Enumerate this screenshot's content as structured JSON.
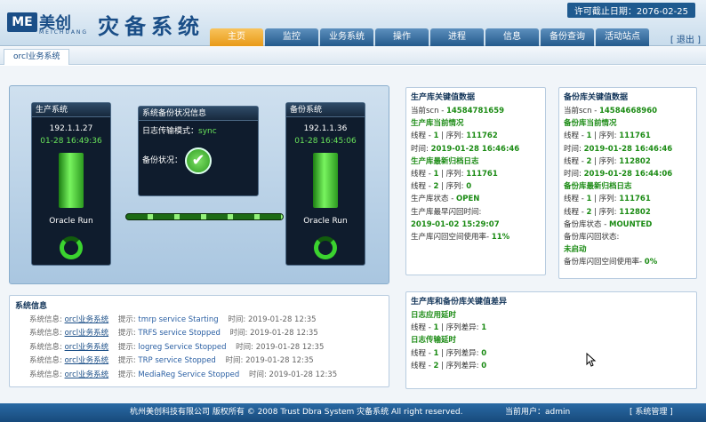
{
  "header": {
    "logo_mark": "ME",
    "logo_brand": "美创",
    "logo_sub": "MEICHUANG",
    "app_title": "灾备系统",
    "license": "许可截止日期：2076-02-25",
    "logout": "[ 退出 ]"
  },
  "nav": [
    "主页",
    "监控",
    "业务系统",
    "操作",
    "进程",
    "信息",
    "备份查询",
    "活动站点"
  ],
  "tab": "orcl业务系统",
  "production": {
    "title": "生产系统",
    "ip": "192.1.1.27",
    "time": "01-28 16:49:36",
    "status": "Oracle Run"
  },
  "backup_status": {
    "title": "系统备份状况信息",
    "mode_label": "日志传输模式：",
    "mode_value": "sync",
    "status_label": "备份状况："
  },
  "backup": {
    "title": "备份系统",
    "ip": "192.1.1.36",
    "time": "01-28 16:45:06",
    "status": "Oracle Run"
  },
  "prod_key": {
    "title": "生产库关键值数据",
    "scn_label": "当前scn - ",
    "scn": "14584781659",
    "cur_title": "生产库当前情况",
    "thread_label": "线程 - ",
    "thread": "1",
    "seq_label": " | 序列: ",
    "seq": "111762",
    "time_label": "时间: ",
    "time": "2019-01-28 16:46:46",
    "arch_title": "生产库最新归档日志",
    "a1_thread": "1",
    "a1_seq": "111761",
    "a2_thread": "2",
    "a2_seq": "0",
    "state_label": "生产库状态 - ",
    "state": "OPEN",
    "flash_label": "生产库最早闪回时间:",
    "flash_time": "2019-01-02 15:29:07",
    "usage_label": "生产库闪回空间使用率- ",
    "usage": "11%"
  },
  "backup_key": {
    "title": "备份库关键值数据",
    "scn_label": "当前scn - ",
    "scn": "14584668960",
    "cur_title": "备份库当前情况",
    "t1_thread": "1",
    "t1_seq": "111761",
    "time_label": "时间: ",
    "t1_time": "2019-01-28 16:46:46",
    "t2_thread": "2",
    "t2_seq": "112802",
    "t2_time": "2019-01-28 16:44:06",
    "arch_title": "备份库最新归档日志",
    "a1_thread": "1",
    "a1_seq": "111761",
    "a2_thread": "2",
    "a2_seq": "112802",
    "state_label": "备份库状态 - ",
    "state": "MOUNTED",
    "flash_label": "备份库闪回状态:",
    "flash_state": "未启动",
    "usage_label": "备份库闪回空间使用率- ",
    "usage": "0%"
  },
  "diff": {
    "title": "生产库和备份库关键值差异",
    "apply_title": "日志应用延时",
    "apply_thread": "1",
    "apply_diff": "1",
    "transfer_title": "日志传输延时",
    "t1_thread": "1",
    "t1_diff": "0",
    "t2_thread": "2",
    "t2_diff": "0",
    "diff_label": " | 序列差异: "
  },
  "sysinfo": {
    "title": "系统信息",
    "rows": [
      {
        "label": "系统信息:",
        "link": "orcl业务系统",
        "tip": "提示:",
        "msg": "tmrp service Starting",
        "time_label": "时间:",
        "time": "2019-01-28 12:35"
      },
      {
        "label": "系统信息:",
        "link": "orcl业务系统",
        "tip": "提示:",
        "msg": "TRFS service Stopped",
        "time_label": "时间:",
        "time": "2019-01-28 12:35"
      },
      {
        "label": "系统信息:",
        "link": "orcl业务系统",
        "tip": "提示:",
        "msg": "logreg Service Stopped",
        "time_label": "时间:",
        "time": "2019-01-28 12:35"
      },
      {
        "label": "系统信息:",
        "link": "orcl业务系统",
        "tip": "提示:",
        "msg": "TRP service Stopped",
        "time_label": "时间:",
        "time": "2019-01-28 12:35"
      },
      {
        "label": "系统信息:",
        "link": "orcl业务系统",
        "tip": "提示:",
        "msg": "MediaReg Service Stopped",
        "time_label": "时间:",
        "time": "2019-01-28 12:35"
      }
    ]
  },
  "footer": {
    "copyright": "杭州美创科技有限公司 版权所有 © 2008 Trust Dbra System 灾备系统 All right reserved.",
    "user_label": "当前用户：",
    "user": "admin",
    "sysmgr": "[ 系统管理 ]"
  },
  "colors": {
    "accent_green": "#1b8b14",
    "brand_blue": "#1a4e87",
    "nav_active": "#e89a18"
  },
  "icons": [
    "check-circle-icon",
    "loading-ring-icon",
    "cursor-icon"
  ]
}
